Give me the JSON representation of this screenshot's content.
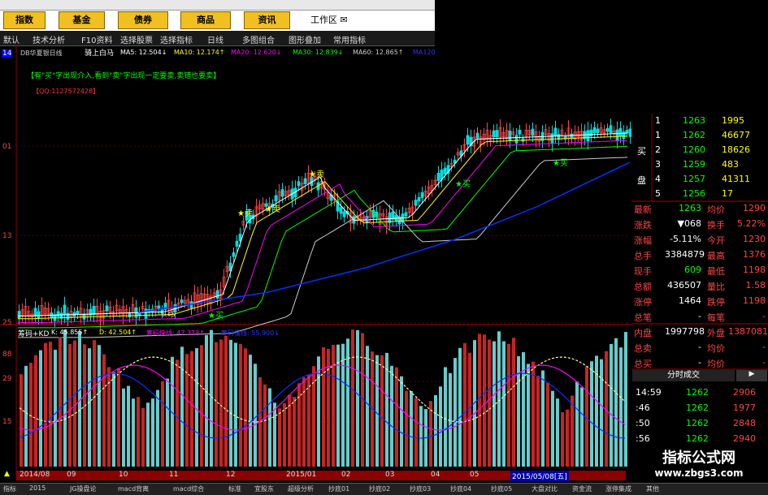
{
  "top_buttons": [
    "指数",
    "基金",
    "债券",
    "商品",
    "资讯"
  ],
  "work_area": "工作区",
  "toolbar": [
    "默认",
    "技术分析",
    "F10资料",
    "选择股票",
    "选择指标",
    "日线",
    "多图组合",
    "图形叠加",
    "常用指标"
  ],
  "side_num": "14",
  "info": {
    "name": "DB华夏银日线",
    "title": "骑上白马",
    "ma5": "MA5: 12.504↓",
    "ma10": "MA10: 12.174↑",
    "ma20": "MA20: 12.620↓",
    "ma30": "MA30: 12.839↓",
    "ma60": "MA60: 12.865↑",
    "ma120": "MA120"
  },
  "tips": "【有\"买\"字出现介入,看到\"卖\"字出现一定要卖,卖错也要卖】",
  "qq": "【QQ:1127572428】",
  "y_labels": [
    "01",
    "13",
    "25"
  ],
  "marks": {
    "buy": "★买",
    "sell": "★卖",
    "low": "6.45"
  },
  "sub_info": {
    "name": "筹码+KD",
    "k": "K: 45.855↑",
    "d": "D: 42.504↑",
    "chip1": "筹码快线: 47.373↑",
    "chip2": "筹码慢线: 55.900↓"
  },
  "sub_y": [
    "88",
    "29",
    "15"
  ],
  "order_book": [
    {
      "side": "",
      "lvl": "1",
      "price": "1263",
      "vol": "1995"
    },
    {
      "side": "",
      "lvl": "1",
      "price": "1262",
      "vol": "46677"
    },
    {
      "side": "买",
      "lvl": "2",
      "price": "1260",
      "vol": "18626"
    },
    {
      "side": "",
      "lvl": "3",
      "price": "1259",
      "vol": "483"
    },
    {
      "side": "盘",
      "lvl": "4",
      "price": "1257",
      "vol": "41311"
    },
    {
      "side": "",
      "lvl": "5",
      "price": "1256",
      "vol": "17"
    }
  ],
  "quote": [
    [
      "最新",
      "1263",
      "均价",
      "1290"
    ],
    [
      "涨跌",
      "▼068",
      "换手",
      "5.22%"
    ],
    [
      "涨幅",
      "-5.11%",
      "今开",
      "1230"
    ],
    [
      "总手",
      "3384879",
      "最高",
      "1376"
    ],
    [
      "现手",
      "609",
      "最低",
      "1198"
    ],
    [
      "总额",
      "436507",
      "量比",
      "1.58"
    ],
    [
      "涨停",
      "1464",
      "跌停",
      "1198"
    ],
    [
      "总笔",
      "-",
      "每笔",
      "-"
    ],
    [
      "内盘",
      "1997798",
      "外盘",
      "1387081"
    ],
    [
      "总卖",
      "-",
      "均价",
      "-"
    ],
    [
      "总买",
      "-",
      "均价",
      "-"
    ]
  ],
  "tick_header": "分时成交",
  "ticks": [
    {
      "time": "14:59",
      "price": "1262",
      "vol": "2906"
    },
    {
      "time": ":46",
      "price": "1262",
      "vol": "1977"
    },
    {
      "time": ":50",
      "price": "1262",
      "vol": "2848"
    },
    {
      "time": ":56",
      "price": "1262",
      "vol": "2940"
    }
  ],
  "dates": [
    "2014/08",
    "09",
    "10",
    "11",
    "12",
    "2015/01",
    "02",
    "03",
    "04",
    "05"
  ],
  "date_selected": "2015/05/08[五]",
  "bottom_tabs": [
    "指标",
    "2015",
    "JG操盘论",
    "macd背离",
    "macd综合",
    "标准",
    "宜股东",
    "超级分析",
    "抄底01",
    "抄底02",
    "抄底03",
    "抄底04",
    "抄底05",
    "大盘对比",
    "资金流",
    "涨停集成",
    "其他"
  ],
  "watermark": {
    "line1": "指标公式网",
    "line2": "www.zbgs3.com"
  },
  "colors": {
    "up": "#ff3333",
    "down": "#00cccc",
    "ma5": "#ffffff",
    "ma10": "#ffff00",
    "ma20": "#ff00ff",
    "ma30": "#00ff00",
    "ma60": "#cccccc",
    "ma120": "#0033ff"
  }
}
